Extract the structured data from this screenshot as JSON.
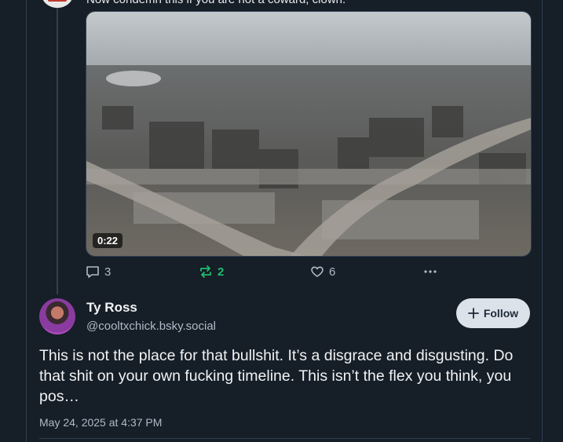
{
  "previous_post": {
    "text": "Now condemn this if you are not a coward, clown.",
    "video": {
      "duration": "0:22"
    },
    "actions": {
      "replies": "3",
      "reposts": "2",
      "likes": "6"
    }
  },
  "post": {
    "author": {
      "display_name": "Ty Ross",
      "handle": "@cooltxchick.bsky.social"
    },
    "follow_label": "Follow",
    "text": "This is not the place for that bullshit. It’s a disgrace and disgusting. Do that shit on your own fucking timeline. This isn’t the flex you think, you pos…",
    "timestamp": "May 24, 2025 at 4:37 PM"
  },
  "colors": {
    "background": "#161e27",
    "repost_active": "#20bc6c",
    "muted": "#aebbc9"
  }
}
